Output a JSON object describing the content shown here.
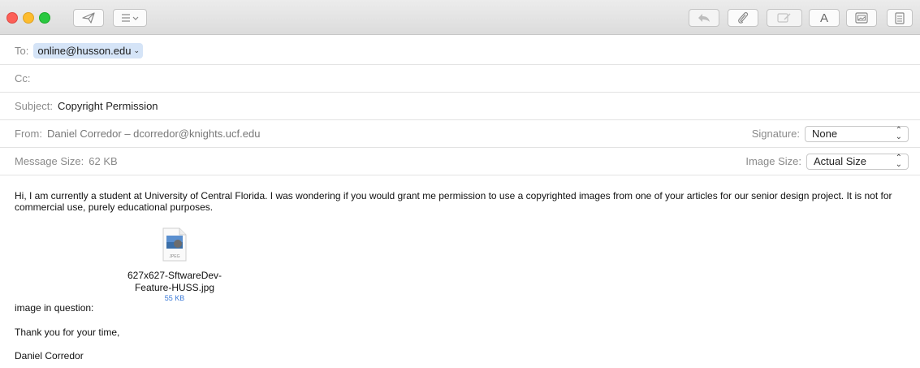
{
  "toolbar": {
    "buttons": [
      {
        "name": "send-button",
        "icon": "paper-plane-icon"
      },
      {
        "name": "header-fields-button",
        "icon": "list-icon"
      },
      {
        "name": "reply-button",
        "icon": "reply-arrow-icon"
      },
      {
        "name": "attach-button",
        "icon": "paperclip-icon"
      },
      {
        "name": "markup-button",
        "icon": "markup-icon"
      },
      {
        "name": "format-button",
        "icon": "font-icon",
        "label": "A"
      },
      {
        "name": "photo-browser-button",
        "icon": "photo-icon"
      },
      {
        "name": "stationery-button",
        "icon": "stationery-icon"
      }
    ]
  },
  "header": {
    "to_label": "To:",
    "to_value": "online@husson.edu",
    "cc_label": "Cc:",
    "subject_label": "Subject:",
    "subject_value": "Copyright Permission",
    "from_label": "From:",
    "from_value": "Daniel Corredor – dcorredor@knights.ucf.edu",
    "signature_label": "Signature:",
    "signature_value": "None",
    "message_size_label": "Message Size:",
    "message_size_value": "62 KB",
    "image_size_label": "Image Size:",
    "image_size_value": "Actual Size"
  },
  "message": {
    "paragraph": "Hi, I am currently a student at University of Central Florida. I was wondering if you would grant me permission to use a copyrighted images from one of your articles for our senior design project. It is not for commercial use, purely educational purposes.",
    "attachment": {
      "file_type": "JPEG",
      "filename_line1": "627x627-SftwareDev-",
      "filename_line2": "Feature-HUSS.jpg",
      "size": "55 KB"
    },
    "image_caption": "image in question:",
    "closing": "Thank you for your time,",
    "signature": "Daniel Corredor"
  },
  "colors": {
    "chip_bg": "#d5e4f7",
    "attachment_size": "#3d7bd8",
    "label_gray": "#8a8a8a"
  }
}
